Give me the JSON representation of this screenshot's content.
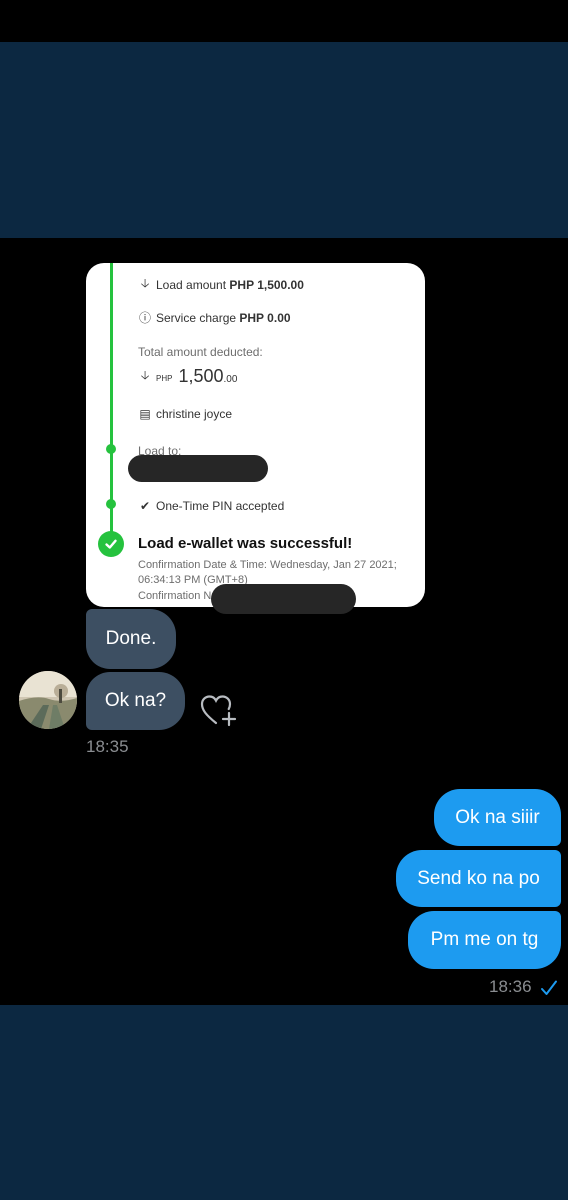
{
  "receipt": {
    "load_amount_label": "Load amount",
    "load_amount_value": "PHP 1,500.00",
    "service_charge_label": "Service charge",
    "service_charge_value": "PHP 0.00",
    "total_label": "Total amount deducted:",
    "total_currency": "PHP",
    "total_whole": "1,500",
    "total_cents": ".00",
    "name": "christine joyce",
    "load_to_label": "Load to:",
    "pin_status": "One-Time PIN accepted",
    "success_title": "Load e-wallet was successful!",
    "confirmation_line1": "Confirmation Date & Time: Wednesday, Jan 27 2021;",
    "confirmation_line2": "06:34:13 PM (GMT+8)",
    "confirmation_line3": "Confirmation N",
    "accent_color": "#25c23e"
  },
  "incoming": {
    "messages": [
      "Done.",
      "Ok na?"
    ],
    "time": "18:35",
    "bubble_color": "#3d4f62"
  },
  "outgoing": {
    "messages": [
      "Ok na siiir",
      "Send ko na po",
      "Pm me on tg"
    ],
    "time": "18:36",
    "bubble_color": "#1d9bf0"
  },
  "icons": {
    "react": "heart-plus-icon",
    "read_receipt": "checkmark-icon"
  },
  "colors": {
    "chat_background": "#000000",
    "frame_background": "#0c2841"
  }
}
